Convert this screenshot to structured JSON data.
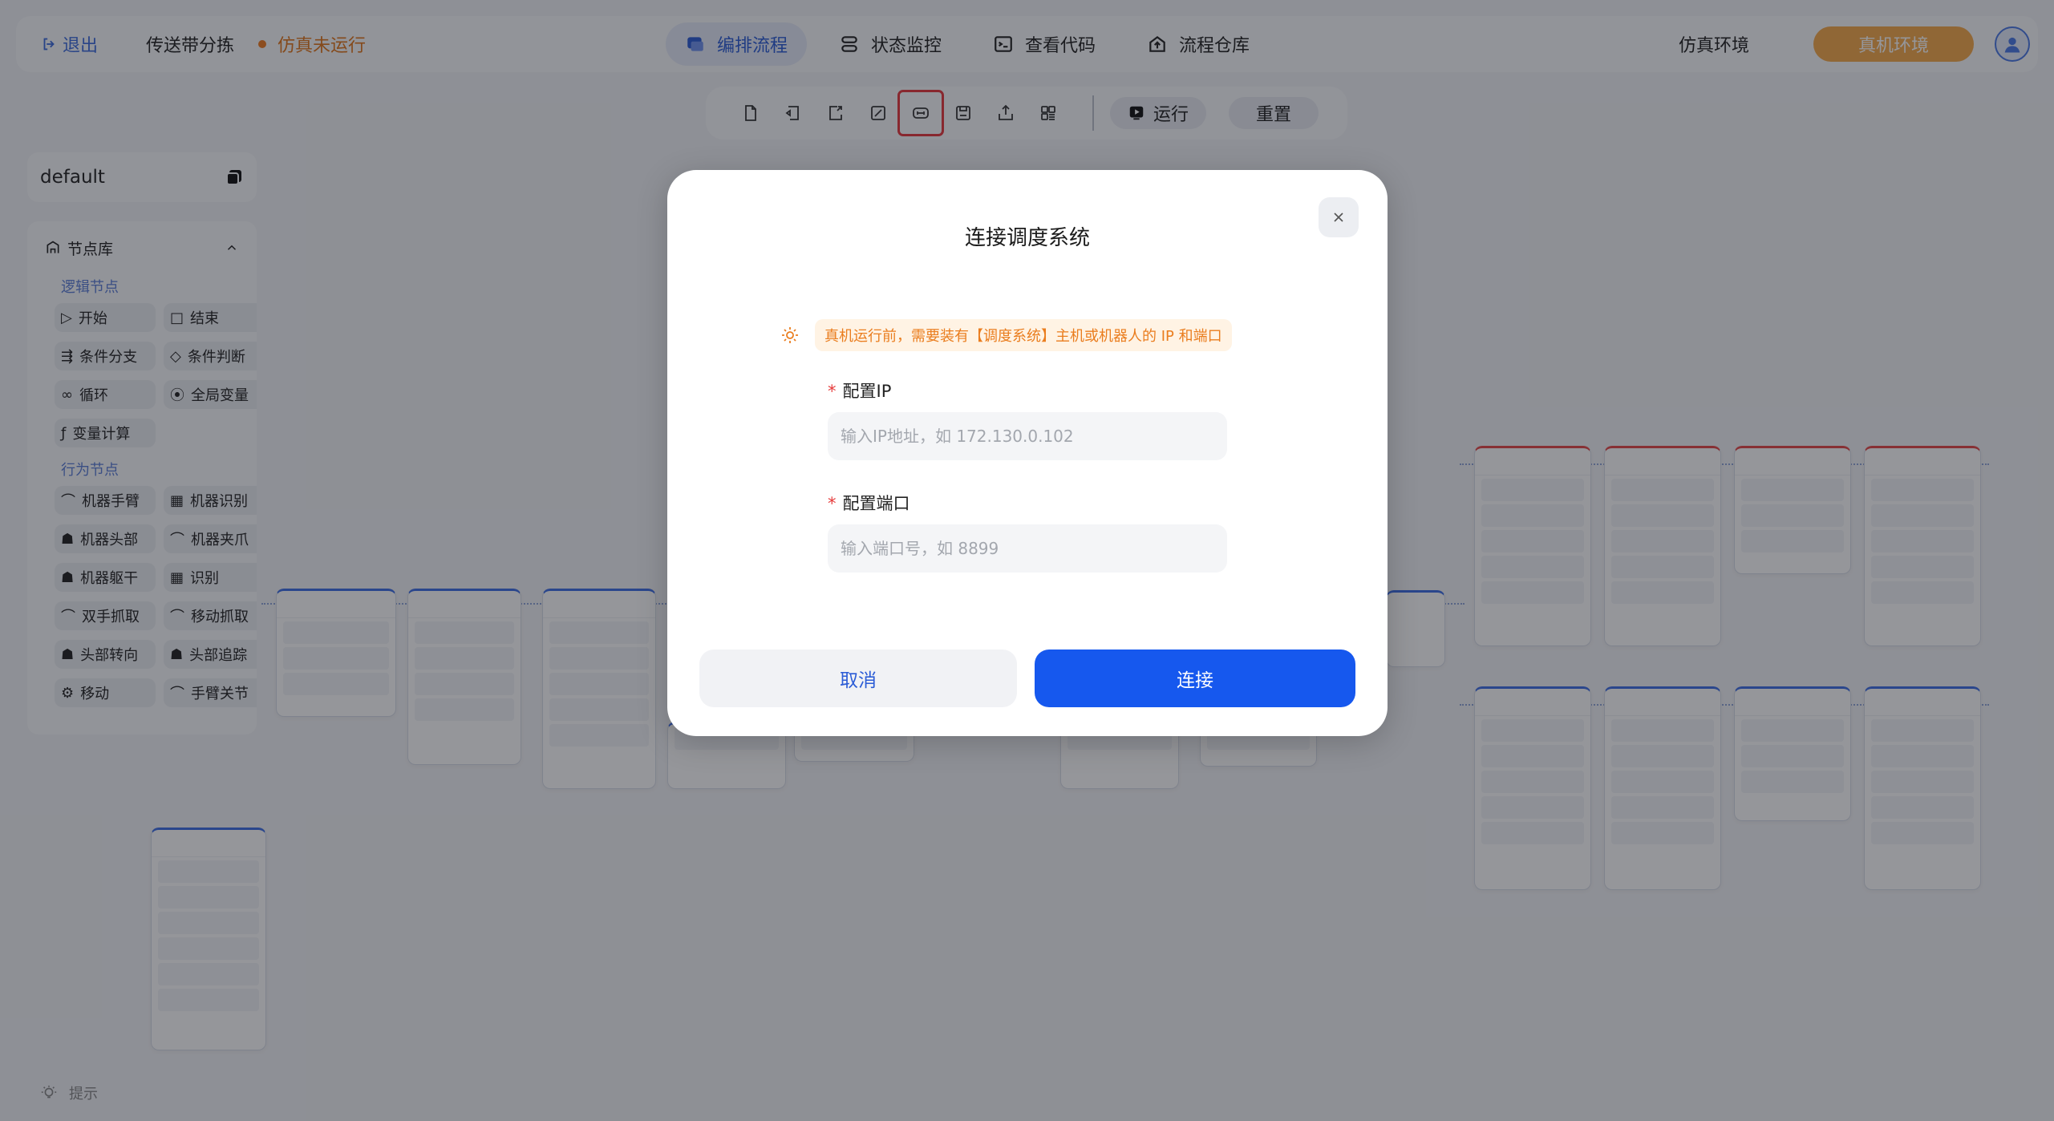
{
  "topbar": {
    "exit_label": "退出",
    "project_name": "传送带分拣",
    "sim_status": "仿真未运行",
    "tabs": [
      {
        "label": "编排流程",
        "icon": "flow-icon",
        "active": true
      },
      {
        "label": "状态监控",
        "icon": "monitor-icon",
        "active": false
      },
      {
        "label": "查看代码",
        "icon": "code-icon",
        "active": false
      },
      {
        "label": "流程仓库",
        "icon": "repository-icon",
        "active": false
      }
    ],
    "sim_env_label": "仿真环境",
    "real_env_label": "真机环境"
  },
  "toolbar": {
    "tools": [
      "new-file-icon",
      "undo-icon",
      "redo-icon",
      "edit-icon",
      "connect-scheduler-icon",
      "save-icon",
      "export-icon",
      "grid-icon"
    ],
    "highlighted_tool": "connect-scheduler-icon",
    "run_label": "运行",
    "reset_label": "重置"
  },
  "sidebar": {
    "workspace": "default",
    "library_title": "节点库",
    "logic_section": "逻辑节点",
    "logic_nodes": [
      "开始",
      "结束",
      "条件分支",
      "条件判断",
      "循环",
      "全局变量",
      "变量计算"
    ],
    "behavior_section": "行为节点",
    "behavior_nodes": [
      "机器手臂",
      "机器识别",
      "机器头部",
      "机器夹爪",
      "机器躯干",
      "识别",
      "双手抓取",
      "移动抓取",
      "头部转向",
      "头部追踪",
      "移动",
      "手臂关节"
    ],
    "hint_label": "提示"
  },
  "modal": {
    "title": "连接调度系统",
    "notice": "真机运行前，需要装有【调度系统】主机或机器人的 IP 和端口",
    "ip_label": "配置IP",
    "ip_placeholder": "输入IP地址，如 172.130.0.102",
    "port_label": "配置端口",
    "port_placeholder": "输入端口号，如 8899",
    "required_mark": "*",
    "cancel_label": "取消",
    "connect_label": "连接"
  },
  "colors": {
    "primary": "#1658ee",
    "accent_orange": "#ea7d1e",
    "real_env": "#f6a94a",
    "error_red": "#e63b3b"
  }
}
